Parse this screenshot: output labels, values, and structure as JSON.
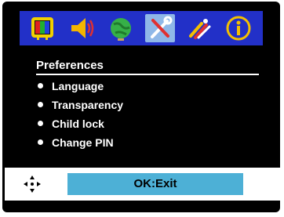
{
  "icon_bar": {
    "icons": [
      {
        "name": "tv-picture-icon"
      },
      {
        "name": "sound-speaker-icon"
      },
      {
        "name": "globe-setup-icon"
      },
      {
        "name": "tools-settings-icon",
        "selected": true
      },
      {
        "name": "connection-plug-icon"
      },
      {
        "name": "info-icon"
      }
    ]
  },
  "menu": {
    "title": "Preferences",
    "items": [
      {
        "label": "Language"
      },
      {
        "label": "Transparency"
      },
      {
        "label": "Child lock"
      },
      {
        "label": "Change PIN"
      }
    ]
  },
  "footer": {
    "nav_icon": "dpad-navigation-icon",
    "ok_label": "OK:Exit"
  },
  "colors": {
    "panel_background": "#000000",
    "icon_bar_background": "#2230c8",
    "selected_icon_highlight": "#8fb8e8",
    "ok_bar": "#4db0d6",
    "text": "#ffffff"
  }
}
